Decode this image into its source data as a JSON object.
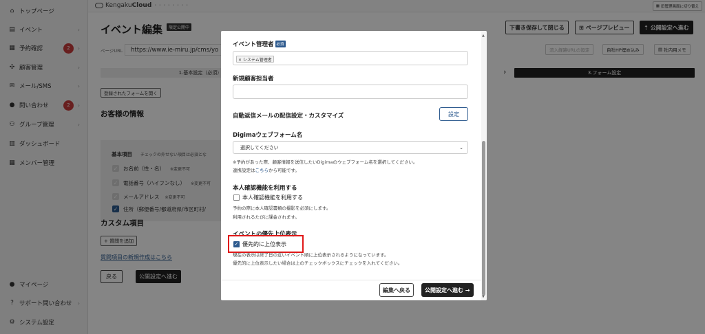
{
  "sidebar": {
    "items": [
      {
        "label": "トップページ",
        "icon": "home-icon",
        "glyph": "⌂",
        "chev": ""
      },
      {
        "label": "イベント",
        "icon": "document-icon",
        "glyph": "▤",
        "chev": "›"
      },
      {
        "label": "予約確認",
        "icon": "calendar-icon",
        "glyph": "▦",
        "chev": "›",
        "badge": "2"
      },
      {
        "label": "顧客管理",
        "icon": "users-icon",
        "glyph": "✣",
        "chev": "›"
      },
      {
        "label": "メール/SMS",
        "icon": "mail-icon",
        "glyph": "✉",
        "chev": "›"
      },
      {
        "label": "問い合わせ",
        "icon": "chat-icon",
        "glyph": "●",
        "chev": "›",
        "badge": "2"
      },
      {
        "label": "グループ管理",
        "icon": "group-icon",
        "glyph": "⚇",
        "chev": "›"
      },
      {
        "label": "ダッシュボード",
        "icon": "dashboard-icon",
        "glyph": "▥",
        "chev": ""
      },
      {
        "label": "メンバー管理",
        "icon": "grid-icon",
        "glyph": "▦",
        "chev": ""
      }
    ],
    "bottom": [
      {
        "label": "マイページ",
        "icon": "person-icon",
        "glyph": "👤"
      },
      {
        "label": "サポート問い合わせ",
        "icon": "help-icon",
        "glyph": "?",
        "chev": "›"
      },
      {
        "label": "システム設定",
        "icon": "gear-icon",
        "glyph": "⚙"
      }
    ]
  },
  "topbar": {
    "logo_plain": "Kengaku",
    "logo_bold": "Cloud",
    "logo_tag": "• • • • • • • •",
    "admin_switch": "旧管理画面に切り替え"
  },
  "page": {
    "title": "イベント編集",
    "status": "限定公開中",
    "save_close": "下書き保存して閉じる",
    "preview": "ページプレビュー",
    "publish_settings": "公開設定へ進む",
    "url_label": "ページURL",
    "url_value": "https://www.ie-miru.jp/cms/yo",
    "embed_url": "流入経路URLの設定",
    "hp_embed": "自社HP埋め込み",
    "internal_memo": "社内用メモ"
  },
  "steps": {
    "step1": "1.基本設定（必須）",
    "step3": "3.フォーム設定"
  },
  "form": {
    "open_registered": "登録されたフォームを開く",
    "customer_info": "お客様の情報",
    "basic_items": "基本項目",
    "basic_note": "チェックの外せない項目は必須とな",
    "fields": [
      {
        "label": "お名前（性・名）",
        "note": "※変更不可",
        "checked": false
      },
      {
        "label": "電話番号（ハイフンなし）",
        "note": "※変更不可",
        "checked": false
      },
      {
        "label": "メールアドレス",
        "note": "※変更不可",
        "checked": false
      },
      {
        "label": "住所（郵便番号/都道府県/市区町村/",
        "note": "",
        "checked": true
      }
    ],
    "custom_items": "カスタム項目",
    "add_question": "+ 質問を追加",
    "new_question_link": "質問項目の新規作成はこちら",
    "back": "戻る",
    "next": "公開設定へ進む"
  },
  "modal": {
    "manager_label": "イベント管理者",
    "required": "必須",
    "manager_chip": "× システム管理者",
    "new_customer_label": "新規顧客担当者",
    "auto_mail_label": "自動返信メールの配信設定・カスタマイズ",
    "settings_button": "設定",
    "digima_label": "Digimaウェブフォーム名",
    "digima_select": "選択してください",
    "digima_note1": "※予約があった際、顧客情報を送信したいDigimaのウェブフォーム名を選択してください。",
    "digima_note2_pre": "連携設定は",
    "digima_note2_link": "こちら",
    "digima_note2_post": "から可能です。",
    "identity_label": "本人確認機能を利用する",
    "identity_check": "本人確認機能を利用する",
    "identity_note1": "予約の際に本人確認書類の撮影を必須にします。",
    "identity_note2": "利用されるたびに課金されます。",
    "priority_label": "イベントの優先上位表示",
    "priority_check": "優先的に上位表示",
    "priority_note1": "現在の表示は終了日の近いイベント順に上位表示されるようになっています。",
    "priority_note2": "優先的に上位表示したい場合は上のチェックボックスにチェックを入れてください。",
    "back_to_edit": "編集へ戻る",
    "go_publish": "公開設定へ進む →"
  }
}
